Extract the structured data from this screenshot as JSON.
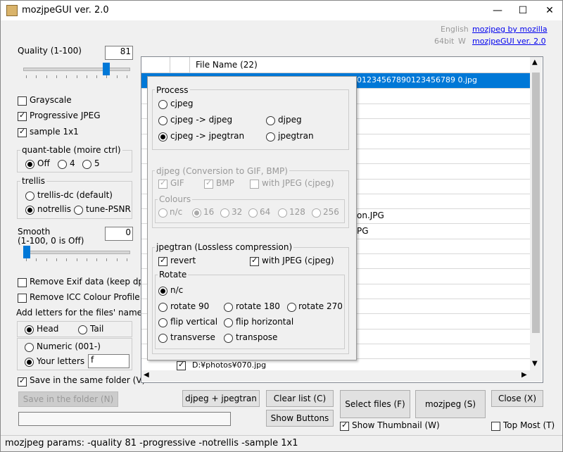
{
  "window": {
    "title": "mozjpeGUI ver. 2.0",
    "minimize": "—",
    "maximize": "☐",
    "close": "✕"
  },
  "header_links": {
    "language": "English",
    "mozjpeg_link": "mozjpeg by mozilla",
    "bits": "64bit",
    "w": "W",
    "gui_link": "mozjpeGUI ver. 2.0"
  },
  "quality": {
    "label": "Quality (1-100)",
    "value": "81",
    "fraction": 0.81
  },
  "options": {
    "grayscale": "Grayscale",
    "progressive": "Progressive JPEG",
    "sample": "sample 1x1"
  },
  "quant_table": {
    "label": "quant-table (moire ctrl)",
    "off": "Off",
    "opt4": "4",
    "opt5": "5"
  },
  "trellis": {
    "label": "trellis",
    "dc": "trellis-dc (default)",
    "notrellis": "notrellis",
    "tune": "tune-PSNR"
  },
  "smooth": {
    "label_line1": "Smooth",
    "label_line2": "(1-100, 0 is Off)",
    "value": "0",
    "fraction": 0.0
  },
  "remove": {
    "exif": "Remove Exif data (keep dpi)",
    "icc": "Remove ICC Colour Profile"
  },
  "add_letters": {
    "label": "Add letters for the files' name",
    "head": "Head",
    "tail": "Tail",
    "numeric": "Numeric (001-)",
    "your_letters": "Your letters",
    "letters_value": "f"
  },
  "save_same": "Save in the same folder (V)",
  "save_in_folder": "Save in the folder (N)",
  "list": {
    "header": "File Name (22)",
    "selected_suffix": "01234567890123456789 0.jpg",
    "row_jpg": "on.JPG",
    "row_pg": "PG",
    "last_row": "D:¥photos¥070.jpg"
  },
  "process": {
    "title": "Process",
    "cjpeg": "cjpeg",
    "cjpeg_djpeg": "cjpeg -> djpeg",
    "djpeg": "djpeg",
    "cjpeg_jpegtran": "cjpeg -> jpegtran",
    "jpegtran": "jpegtran"
  },
  "djpeg_group": {
    "title": "djpeg (Conversion to GIF, BMP)",
    "gif": "GIF",
    "bmp": "BMP",
    "with_jpeg": "with JPEG (cjpeg)",
    "colours": "Colours",
    "nc": "n/c",
    "c16": "16",
    "c32": "32",
    "c64": "64",
    "c128": "128",
    "c256": "256"
  },
  "jpegtran_group": {
    "title": "jpegtran (Lossless compression)",
    "revert": "revert",
    "with_jpeg": "with JPEG (cjpeg)",
    "rotate": "Rotate",
    "nc": "n/c",
    "r90": "rotate 90",
    "r180": "rotate 180",
    "r270": "rotate 270",
    "flipv": "flip vertical",
    "fliph": "flip horizontal",
    "transverse": "transverse",
    "transpose": "transpose"
  },
  "buttons": {
    "djpeg_jpegtran": "djpeg + jpegtran",
    "clear_list": "Clear list (C)",
    "show_buttons": "Show Buttons",
    "select_files": "Select files (F)",
    "mozjpeg": "mozjpeg (S)",
    "close": "Close (X)",
    "show_thumbnail": "Show Thumbnail (W)",
    "top_most": "Top Most (T)"
  },
  "status": "mozjpeg params: -quality 81 -progressive -notrellis -sample 1x1"
}
